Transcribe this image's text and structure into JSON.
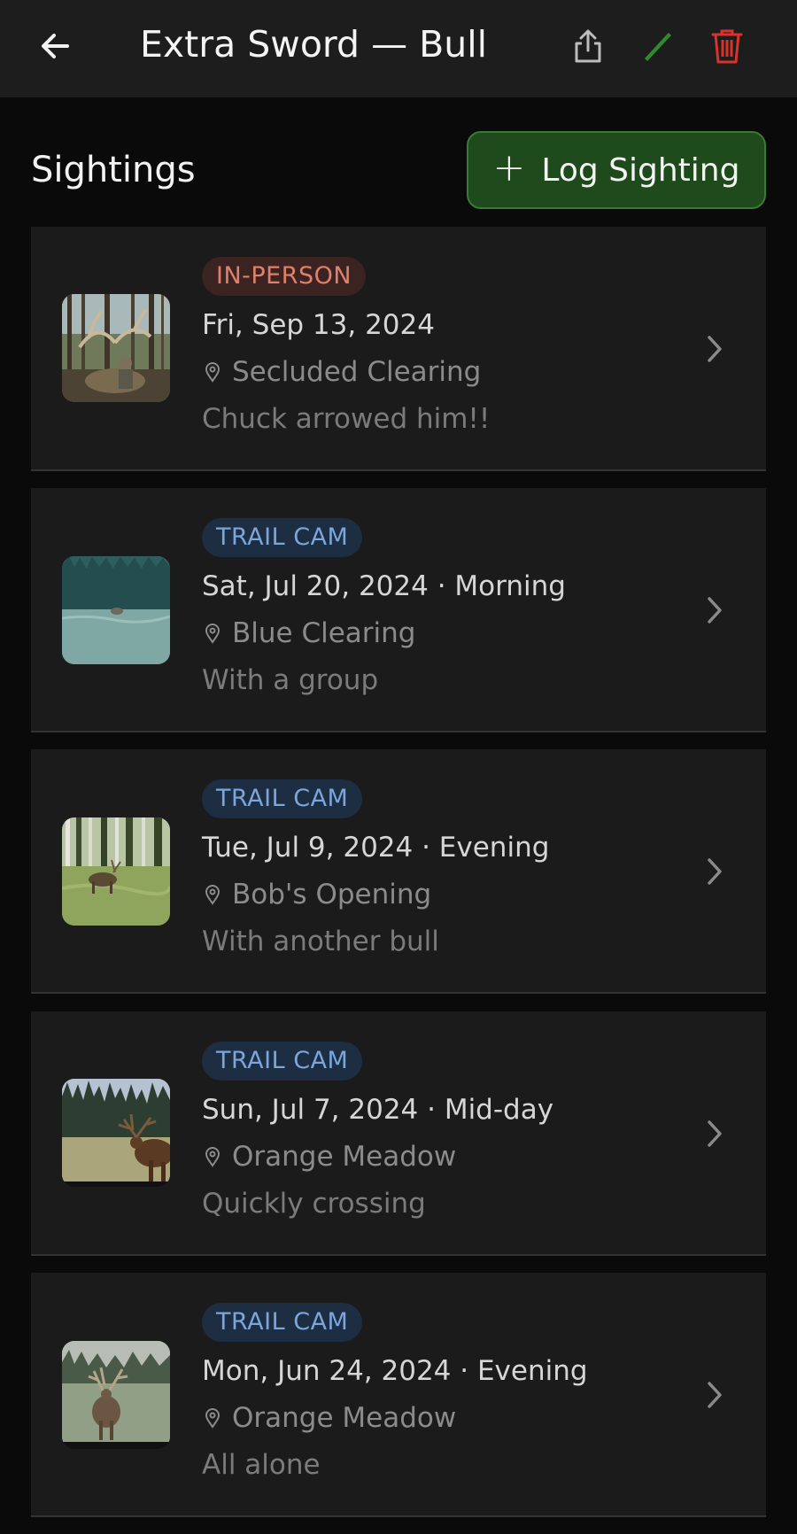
{
  "header": {
    "title": "Extra Sword — Bull",
    "icons": {
      "back": "arrow-left-icon",
      "share": "share-icon",
      "edit": "pencil-icon",
      "delete": "trash-icon"
    },
    "colors": {
      "edit": "#2e8b2e",
      "delete": "#d9332b"
    }
  },
  "sightings": {
    "section_title": "Sightings",
    "log_button": {
      "icon": "+",
      "label": "Log Sighting",
      "color": "#1e4a1c"
    },
    "items": [
      {
        "type": "IN-PERSON",
        "date": "Fri, Sep 13, 2024",
        "location": "Secluded Clearing",
        "note": "Chuck arrowed him!!",
        "thumb": "elk-harvest-photo"
      },
      {
        "type": "TRAIL CAM",
        "date": "Sat, Jul 20, 2024 · Morning",
        "location": "Blue Clearing",
        "note": "With a group",
        "thumb": "trail-cam-photo"
      },
      {
        "type": "TRAIL CAM",
        "date": "Tue, Jul 9, 2024 · Evening",
        "location": "Bob's Opening",
        "note": "With another bull",
        "thumb": "trail-cam-photo"
      },
      {
        "type": "TRAIL CAM",
        "date": "Sun, Jul 7, 2024 · Mid-day",
        "location": "Orange Meadow",
        "note": "Quickly crossing",
        "thumb": "trail-cam-photo"
      },
      {
        "type": "TRAIL CAM",
        "date": "Mon, Jun 24, 2024 · Evening",
        "location": "Orange Meadow",
        "note": "All alone",
        "thumb": "trail-cam-photo"
      }
    ]
  }
}
